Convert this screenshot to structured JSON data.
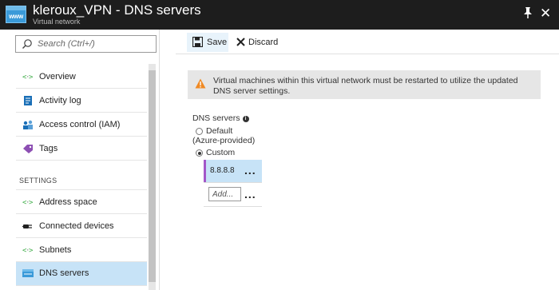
{
  "header": {
    "icon_text": "www",
    "title": "kleroux_VPN - DNS servers",
    "subtitle": "Virtual network"
  },
  "search": {
    "placeholder": "Search (Ctrl+/)"
  },
  "sidebar": {
    "items": [
      {
        "label": "Overview",
        "icon": "network-arrows-icon"
      },
      {
        "label": "Activity log",
        "icon": "activity-log-icon"
      },
      {
        "label": "Access control (IAM)",
        "icon": "users-icon"
      },
      {
        "label": "Tags",
        "icon": "tag-icon"
      }
    ],
    "section_label": "SETTINGS",
    "settings_items": [
      {
        "label": "Address space",
        "icon": "network-arrows-icon"
      },
      {
        "label": "Connected devices",
        "icon": "plug-icon"
      },
      {
        "label": "Subnets",
        "icon": "network-arrows-icon"
      },
      {
        "label": "DNS servers",
        "icon": "dns-server-icon",
        "active": true
      }
    ]
  },
  "toolbar": {
    "save_label": "Save",
    "discard_label": "Discard"
  },
  "warning": {
    "text": "Virtual machines within this virtual network must be restarted to utilize the updated DNS server settings."
  },
  "dns": {
    "label": "DNS servers",
    "options": [
      {
        "label": "Default",
        "selected": false
      },
      {
        "label": "Custom",
        "selected": true
      }
    ],
    "default_sub": "(Azure-provided)",
    "servers": [
      "8.8.8.8"
    ],
    "add_placeholder": "Add...",
    "more_label": "..."
  },
  "colors": {
    "header_bg": "#1d1d1d",
    "active_bg": "#c7e3f7",
    "warning_icon": "#f08a24",
    "entry_accent": "#a357c8"
  }
}
